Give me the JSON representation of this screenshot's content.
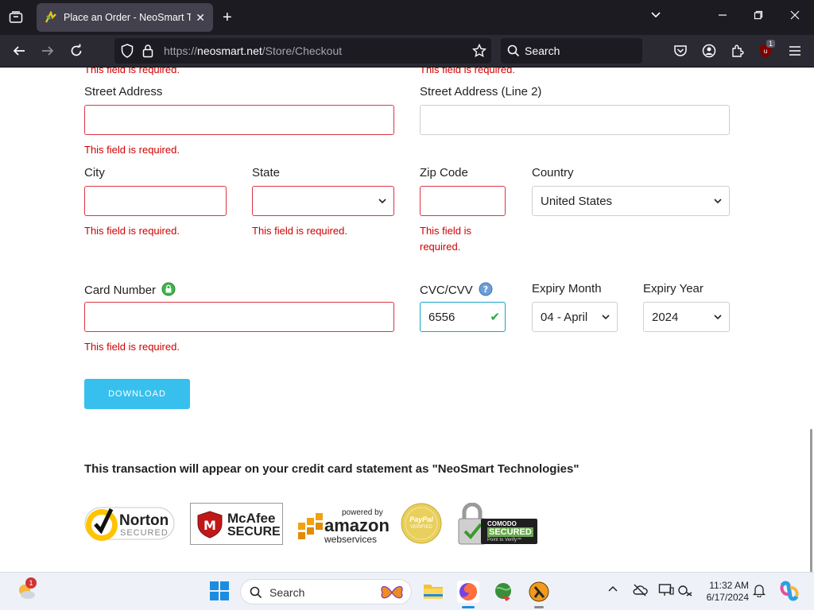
{
  "browser": {
    "tab_title": "Place an Order - NeoSmart Tech",
    "url_prefix": "https://",
    "url_domain": "neosmart.net",
    "url_path": "/Store/Checkout",
    "search_label": "Search",
    "extension_badge": "1"
  },
  "form": {
    "top_errors": [
      "This field is required.",
      "This field is required."
    ],
    "street_label": "Street Address",
    "street_value": "",
    "street_error": "This field is required.",
    "street2_label": "Street Address (Line 2)",
    "street2_value": "",
    "city_label": "City",
    "city_error": "This field is required.",
    "state_label": "State",
    "state_value": "",
    "state_error": "This field is required.",
    "zip_label": "Zip Code",
    "zip_error_line1": "This field is",
    "zip_error_line2": "required.",
    "country_label": "Country",
    "country_value": "United States",
    "card_label": "Card Number",
    "card_error": "This field is required.",
    "cvc_label": "CVC/CVV",
    "cvc_value": "6556",
    "month_label": "Expiry Month",
    "month_value": "04 - April",
    "year_label": "Expiry Year",
    "year_value": "2024",
    "download_label": "DOWNLOAD",
    "notice": "This transaction will appear on your credit card statement as \"NeoSmart Technologies\""
  },
  "badges": {
    "norton_main": "Norton",
    "norton_sub": "SECURED",
    "mcafee_main": "McAfee",
    "mcafee_sub": "SECURE",
    "amazon_top": "powered by",
    "amazon_main": "amazon",
    "amazon_sub": "webservices",
    "paypal_main": "PayPal",
    "paypal_sub": "VERIFIED",
    "comodo_main": "COMODO",
    "comodo_sub": "SECURED",
    "comodo_tag": "Point to Verify™"
  },
  "taskbar": {
    "search_label": "Search",
    "time": "11:32 AM",
    "date": "6/17/2024",
    "weather_badge": "1"
  },
  "colors": {
    "error": "#d00000",
    "invalid_border": "#dc3545",
    "valid_border": "#1fa3c9",
    "button": "#37c0ee"
  }
}
